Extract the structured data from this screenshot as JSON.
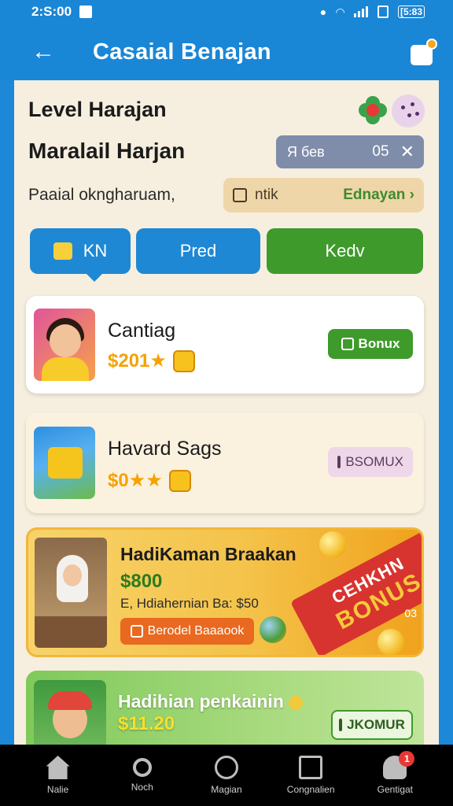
{
  "status_bar": {
    "time": "2:S:00",
    "battery": "[5:83"
  },
  "app_bar": {
    "title": "Casaial Benajan"
  },
  "header": {
    "title": "Level Harajan",
    "subtitle": "Maralail Harjan",
    "search_chip": {
      "label": "Я бев",
      "value": "05"
    },
    "description": "Paaial okngharuam,",
    "note_chip": {
      "label": "ntik",
      "link": "Ednayan"
    }
  },
  "tabs": [
    {
      "label": "KN"
    },
    {
      "label": "Pred"
    },
    {
      "label": "Kedv"
    }
  ],
  "cards": [
    {
      "title": "Cantiag",
      "price": "$201★",
      "button": "Bonux"
    },
    {
      "title": "Havard Sags",
      "price": "$0★★",
      "button": "BSOMUX"
    },
    {
      "title": "HadiKaman Braakan",
      "price": "$800",
      "subtitle": "E, Hdiahernian Ba: $50",
      "button": "Berodel Baaaook",
      "ribbon_top": "CEHKHN",
      "ribbon_bottom": "BONUS",
      "tag": "03"
    },
    {
      "title": "Hadihian penkainin",
      "price": "$11.20",
      "button": "JKOMUR"
    }
  ],
  "bottom_nav": [
    {
      "label": "Nalie",
      "icon": "home-icon"
    },
    {
      "label": "Noch",
      "icon": "search-icon"
    },
    {
      "label": "Magian",
      "icon": "compass-icon"
    },
    {
      "label": "Congnalien",
      "icon": "tv-icon"
    },
    {
      "label": "Gentigat",
      "icon": "user-icon",
      "badge": "1"
    }
  ],
  "colors": {
    "primary": "#1a86d6",
    "accent_green": "#3f9a2c",
    "background": "#f6efdf",
    "badge_red": "#e53935"
  }
}
